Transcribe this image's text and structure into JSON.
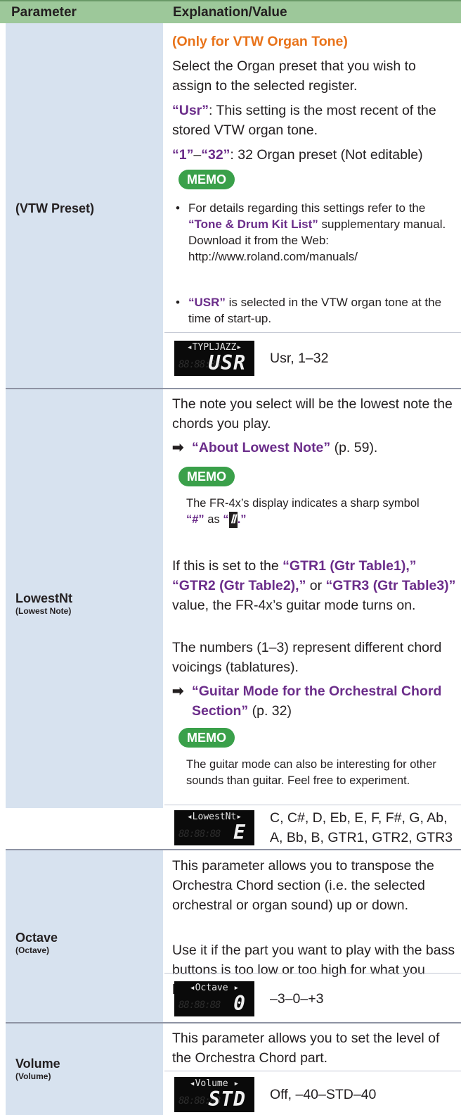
{
  "header": {
    "col1": "Parameter",
    "col2": "Explanation/Value"
  },
  "rows": {
    "vtw": {
      "name": "(VTW Preset)",
      "note": "(Only for VTW Organ Tone)",
      "desc": "Select the Organ preset that you wish to assign to the selected register.",
      "usr_q": "“Usr”",
      "usr_txt": ": This setting is the most recent of the stored VTW organ tone.",
      "range_q1": "“1”",
      "range_dash": "–",
      "range_q2": "“32”",
      "range_txt": ": 32 Organ preset (Not editable)",
      "memo": "MEMO",
      "bullet1_a": "For details regarding this settings refer to the",
      "bullet1_link": "“Tone & Drum Kit List”",
      "bullet1_b": "supplementary manual.",
      "bullet1_c": "Download it from the Web:",
      "bullet1_url": "http://www.roland.com/manuals/",
      "bullet2_q": "“USR”",
      "bullet2_txt": "is selected in the VTW organ tone at the time of start-up.",
      "lcd_top": "◂TYPLJAZZ▸",
      "lcd_ghost": "88:88:88",
      "lcd_big": "USR",
      "values": "Usr, 1–32"
    },
    "lowest": {
      "name": "LowestNt",
      "sub": "(Lowest Note)",
      "desc": "The note you select will be the lowest note the chords you play.",
      "arrow": "➡",
      "ref1": "“About Lowest Note”",
      "ref1_page": "(p. 59).",
      "memo1": "MEMO",
      "memo1_a": "The FR-4x’s display indicates a sharp symbol",
      "memo1_q": "“#”",
      "memo1_as": "as",
      "memo1_open": "“",
      "memo1_glyph": "Ⅱ",
      "memo1_close": ".”",
      "gtr_a": "If this is set to the",
      "gtr1": "“GTR1 (Gtr Table1),”",
      "gtr2": "“GTR2 (Gtr Table2),”",
      "gtr_or": "or",
      "gtr3": "“GTR3 (Gtr Table3)”",
      "gtr_b": "value, the FR-4x’s guitar mode turns on.",
      "numbers": "The numbers (1–3) represent different chord voicings (tablatures).",
      "arrow2": "➡",
      "ref2": "“Guitar Mode for the Orchestral Chord Section”",
      "ref2_page": "(p. 32)",
      "memo2": "MEMO",
      "memo2_txt": "The guitar mode can also be interesting for other sounds than guitar. Feel free to experiment.",
      "lcd_top": "◂LowestNt▸",
      "lcd_ghost": "88:88:88",
      "lcd_big": "E",
      "values": "C, C#, D, Eb, E, F, F#, G, Ab, A, Bb, B, GTR1, GTR2, GTR3"
    },
    "octave": {
      "name": "Octave",
      "sub": "(Octave)",
      "desc1": "This parameter allows you to transpose the Orchestra Chord section (i.e. the selected orchestral or organ sound) up or down.",
      "desc2": "Use it if the part you want to play with the bass buttons is too low or too high for what you have in mind.",
      "lcd_top": "◂Octave   ▸",
      "lcd_ghost": "88:88:88",
      "lcd_big": "0",
      "values": "–3–0–+3"
    },
    "volume": {
      "name": "Volume",
      "sub": "(Volume)",
      "desc": "This parameter allows you to set the level of the Orchestra Chord part.",
      "lcd_top": "◂Volume   ▸",
      "lcd_ghost": "88:88:88",
      "lcd_big": "STD",
      "values": "Off, –40–STD–40"
    }
  },
  "colors": {
    "header_bg": "#9dc89a",
    "param_bg": "#d7e2ef",
    "link_purple": "#6b2d8a",
    "note_orange": "#e8731a",
    "memo_green": "#3aa04a"
  }
}
